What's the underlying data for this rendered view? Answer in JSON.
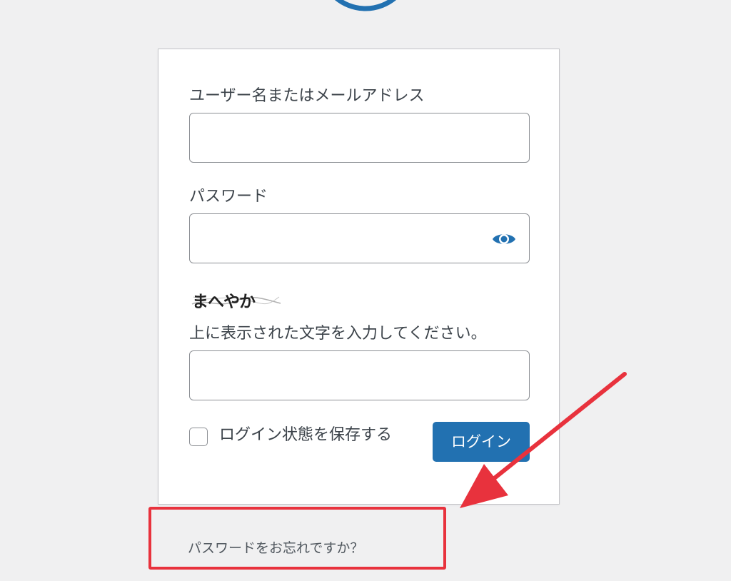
{
  "form": {
    "username_label": "ユーザー名またはメールアドレス",
    "username_value": "",
    "password_label": "パスワード",
    "password_value": "",
    "captcha_text": "まへやか",
    "captcha_label": "上に表示された文字を入力してください。",
    "captcha_value": "",
    "remember_label": "ログイン状態を保存する",
    "remember_checked": false,
    "login_button_label": "ログイン"
  },
  "links": {
    "forgot_password": "パスワードをお忘れですか？"
  },
  "colors": {
    "page_background": "#f0f0f1",
    "accent_blue": "#2271b1",
    "annotation_red": "#e8323d",
    "border_gray": "#8c8f94"
  },
  "icons": {
    "logo": "wordpress-logo-icon",
    "password_toggle": "eye-icon"
  }
}
